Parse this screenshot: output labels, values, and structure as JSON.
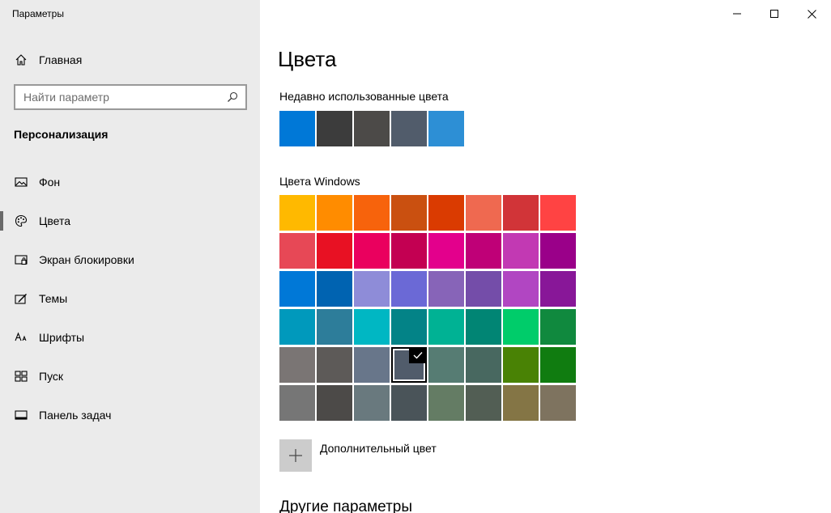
{
  "window": {
    "title": "Параметры",
    "controls": [
      "minimize-icon",
      "maximize-icon",
      "close-icon"
    ]
  },
  "sidebar": {
    "home_label": "Главная",
    "search": {
      "placeholder": "Найти параметр"
    },
    "section_title": "Персонализация",
    "items": [
      {
        "label": "Фон",
        "icon": "picture-icon",
        "selected": false
      },
      {
        "label": "Цвета",
        "icon": "palette-icon",
        "selected": true
      },
      {
        "label": "Экран блокировки",
        "icon": "lock-screen-icon",
        "selected": false
      },
      {
        "label": "Темы",
        "icon": "themes-icon",
        "selected": false
      },
      {
        "label": "Шрифты",
        "icon": "fonts-icon",
        "selected": false
      },
      {
        "label": "Пуск",
        "icon": "start-icon",
        "selected": false
      },
      {
        "label": "Панель задач",
        "icon": "taskbar-icon",
        "selected": false
      }
    ]
  },
  "main": {
    "title": "Цвета",
    "recent_title": "Недавно использованные цвета",
    "recent_colors": [
      "#0078d7",
      "#3c3c3c",
      "#4c4a48",
      "#515c6b",
      "#2d8fd5"
    ],
    "windows_title": "Цвета Windows",
    "windows_colors": [
      [
        "#ffb900",
        "#ff8c00",
        "#f7630c",
        "#ca5010",
        "#da3b01",
        "#ef6950",
        "#d13438",
        "#ff4343"
      ],
      [
        "#e74856",
        "#e81123",
        "#ea005e",
        "#c30052",
        "#e3008c",
        "#bf0077",
        "#c239b3",
        "#9a0089"
      ],
      [
        "#0078d7",
        "#0063b1",
        "#8e8cd8",
        "#6b69d6",
        "#8764b8",
        "#744da9",
        "#b146c2",
        "#881798"
      ],
      [
        "#0099bc",
        "#2d7d9a",
        "#00b7c3",
        "#038387",
        "#00b294",
        "#018574",
        "#00cc6a",
        "#10893e"
      ],
      [
        "#7a7574",
        "#5d5a58",
        "#68768a",
        "#515c6b",
        "#567c73",
        "#486860",
        "#498205",
        "#107c10"
      ],
      [
        "#767676",
        "#4c4a48",
        "#69797e",
        "#4a5459",
        "#647c64",
        "#525e54",
        "#847545",
        "#7e735f"
      ]
    ],
    "selected_color": "#515c6b",
    "add_color_label": "Дополнительный цвет",
    "other_title": "Другие параметры"
  }
}
